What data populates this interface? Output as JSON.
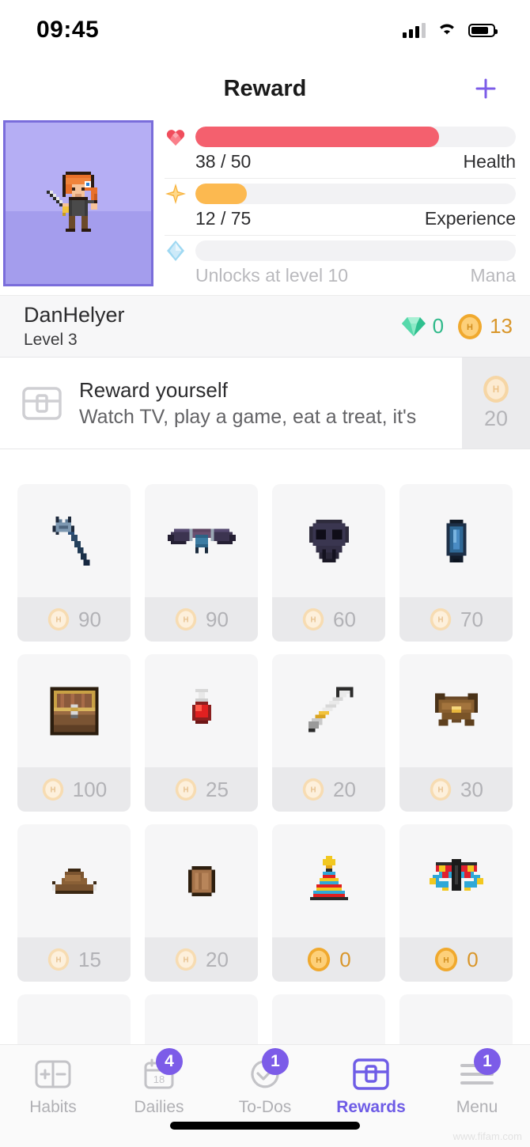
{
  "status_bar": {
    "time": "09:45",
    "icons": [
      "cellular-signal-icon",
      "wifi-icon",
      "battery-icon"
    ]
  },
  "header": {
    "title": "Reward",
    "add_button_icon": "plus-icon"
  },
  "colors": {
    "accent": "#7c5ce8",
    "health": "#f4606e",
    "experience": "#fcb950",
    "mana": "#9fd8f0",
    "gold": "#d9962a",
    "gem": "#2fb98a",
    "avatar_frame": "#7a6ddb",
    "avatar_bg": "#b5aef4"
  },
  "character": {
    "avatar_name": "pixel-warrior-avatar",
    "username": "DanHelyer",
    "level_label": "Level 3",
    "currencies": [
      {
        "name": "gem",
        "icon": "gem-icon",
        "value": "0"
      },
      {
        "name": "gold",
        "icon": "gold-coin-icon",
        "value": "13"
      }
    ],
    "stats": [
      {
        "key": "health",
        "icon": "heart-icon",
        "value_label": "38 / 50",
        "name_label": "Health",
        "current": 38,
        "max": 50,
        "percent": 76,
        "locked": false,
        "fill_color": "#f4606e"
      },
      {
        "key": "experience",
        "icon": "star-icon",
        "value_label": "12 / 75",
        "name_label": "Experience",
        "current": 12,
        "max": 75,
        "percent": 16,
        "locked": false,
        "fill_color": "#fcb950"
      },
      {
        "key": "mana",
        "icon": "mana-diamond-icon",
        "value_label": "Unlocks at level 10",
        "name_label": "Mana",
        "current": 0,
        "max": 0,
        "percent": 0,
        "locked": true,
        "fill_color": "#9fd8f0"
      }
    ]
  },
  "reward_card": {
    "icon": "treasure-chest-icon",
    "title": "Reward yourself",
    "subtitle": "Watch TV, play a game, eat a treat, it's",
    "price": "20",
    "price_icon": "gold-coin-icon"
  },
  "items": [
    {
      "icon": "blue-trident-staff-icon",
      "price": "90",
      "affordable": false
    },
    {
      "icon": "dark-bat-wings-icon",
      "price": "90",
      "affordable": false
    },
    {
      "icon": "black-skull-icon",
      "price": "60",
      "affordable": false
    },
    {
      "icon": "blue-vial-icon",
      "price": "70",
      "affordable": false
    },
    {
      "icon": "treasure-chest-item-icon",
      "price": "100",
      "affordable": false
    },
    {
      "icon": "red-health-potion-icon",
      "price": "25",
      "affordable": false
    },
    {
      "icon": "silver-sword-icon",
      "price": "20",
      "affordable": false
    },
    {
      "icon": "brown-armor-icon",
      "price": "30",
      "affordable": false
    },
    {
      "icon": "brown-hat-icon",
      "price": "15",
      "affordable": false
    },
    {
      "icon": "wooden-shield-icon",
      "price": "20",
      "affordable": false
    },
    {
      "icon": "party-hat-icon",
      "price": "0",
      "affordable": true
    },
    {
      "icon": "rainbow-butterfly-icon",
      "price": "0",
      "affordable": true
    }
  ],
  "tabbar": {
    "tabs": [
      {
        "label": "Habits",
        "icon": "plus-minus-icon",
        "badge": null,
        "active": false
      },
      {
        "label": "Dailies",
        "icon": "calendar-18-icon",
        "badge": "4",
        "active": false
      },
      {
        "label": "To-Dos",
        "icon": "check-circle-icon",
        "badge": "1",
        "active": false
      },
      {
        "label": "Rewards",
        "icon": "chest-icon",
        "badge": null,
        "active": true
      },
      {
        "label": "Menu",
        "icon": "hamburger-icon",
        "badge": "1",
        "active": false
      }
    ]
  },
  "watermark": "www.fifam.com"
}
